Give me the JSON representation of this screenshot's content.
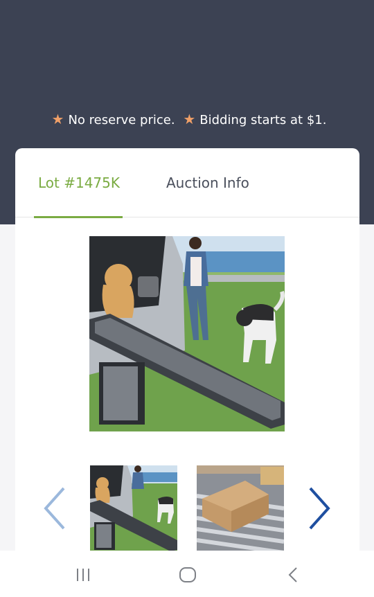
{
  "notice": {
    "part1": "No reserve price.",
    "part2": "Bidding starts at $1.",
    "icon": "star-icon",
    "icon_color": "#f0a068"
  },
  "tabs": [
    {
      "label": "Lot #1475K",
      "active": true
    },
    {
      "label": "Auction Info",
      "active": false
    }
  ],
  "colors": {
    "header_bg": "#3c4253",
    "accent": "#7aab42",
    "arrow_left": "#9bb8dc",
    "arrow_right": "#1f4fa0"
  },
  "gallery": {
    "main_image": "dog ramp product photo",
    "thumbnails": [
      "dog ramp product photo",
      "boxed package on roller conveyor"
    ]
  },
  "nav": {
    "icons": [
      "recent-apps-icon",
      "home-icon",
      "back-icon"
    ]
  }
}
